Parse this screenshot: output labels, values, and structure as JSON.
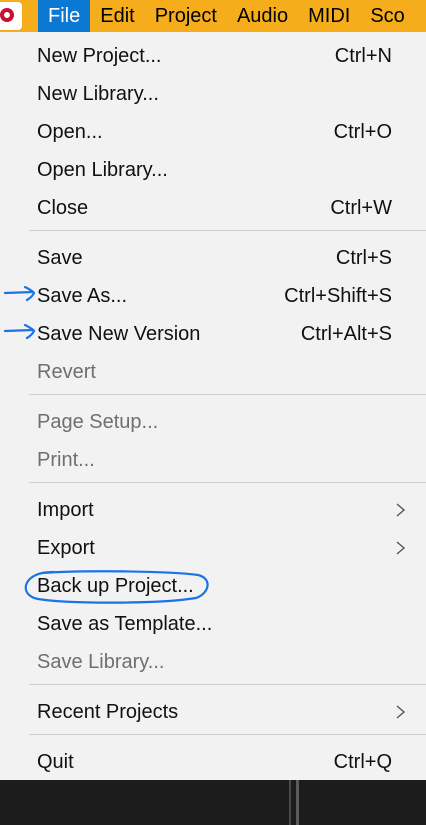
{
  "menubar": {
    "items": [
      {
        "label": "File",
        "active": true
      },
      {
        "label": "Edit"
      },
      {
        "label": "Project"
      },
      {
        "label": "Audio"
      },
      {
        "label": "MIDI"
      },
      {
        "label": "Sco"
      }
    ],
    "accent_color": "#f5ad1b",
    "active_color": "#0b78d4"
  },
  "file_menu": {
    "new_project": {
      "label": "New Project...",
      "shortcut": "Ctrl+N"
    },
    "new_library": {
      "label": "New Library..."
    },
    "open": {
      "label": "Open...",
      "shortcut": "Ctrl+O"
    },
    "open_library": {
      "label": "Open Library..."
    },
    "close": {
      "label": "Close",
      "shortcut": "Ctrl+W"
    },
    "save": {
      "label": "Save",
      "shortcut": "Ctrl+S"
    },
    "save_as": {
      "label": "Save As...",
      "shortcut": "Ctrl+Shift+S"
    },
    "save_new_version": {
      "label": "Save New Version",
      "shortcut": "Ctrl+Alt+S"
    },
    "revert": {
      "label": "Revert",
      "disabled": true
    },
    "page_setup": {
      "label": "Page Setup...",
      "disabled": true
    },
    "print": {
      "label": "Print...",
      "disabled": true
    },
    "import": {
      "label": "Import",
      "submenu": true
    },
    "export": {
      "label": "Export",
      "submenu": true
    },
    "back_up_project": {
      "label": "Back up Project..."
    },
    "save_as_template": {
      "label": "Save as Template..."
    },
    "save_library": {
      "label": "Save Library...",
      "disabled": true
    },
    "recent_projects": {
      "label": "Recent Projects",
      "submenu": true
    },
    "quit": {
      "label": "Quit",
      "shortcut": "Ctrl+Q"
    }
  },
  "annotations": {
    "arrow_color": "#1a73e8",
    "highlight_color": "#1a73e8"
  }
}
